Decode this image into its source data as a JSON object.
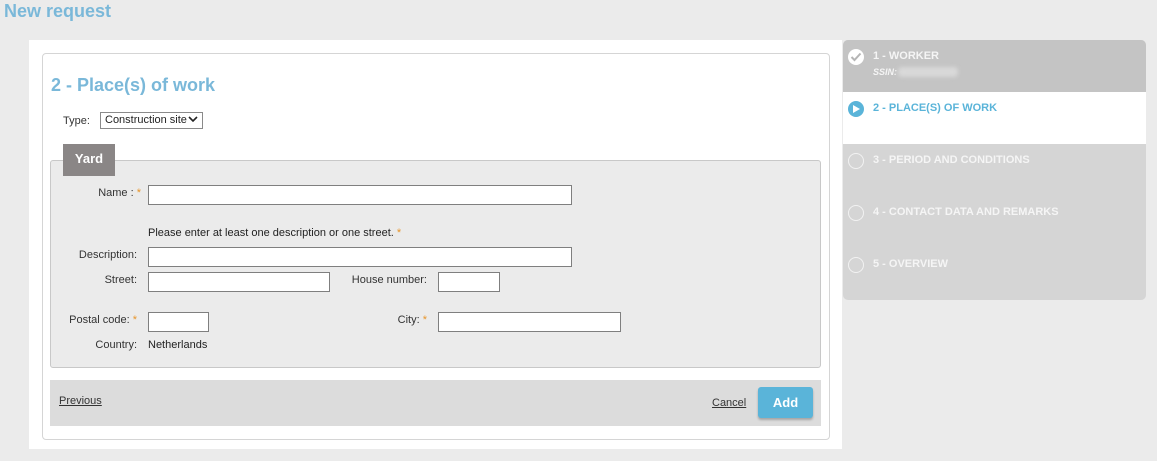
{
  "page": {
    "title": "New request"
  },
  "form": {
    "section_title": "2 - Place(s) of work",
    "type_label": "Type:",
    "type_value": "Construction site",
    "yard_tab": "Yard",
    "name_label": "Name :",
    "required_mark": "*",
    "hint": "Please enter at least one description or one street.",
    "description_label": "Description:",
    "street_label": "Street:",
    "house_number_label": "House number:",
    "postal_code_label": "Postal code:",
    "city_label": "City:",
    "country_label": "Country:",
    "country_value": "Netherlands",
    "name_value": "",
    "description_value": "",
    "street_value": "",
    "house_number_value": "",
    "postal_code_value": "",
    "city_value": ""
  },
  "footer": {
    "previous": "Previous",
    "cancel": "Cancel",
    "add": "Add"
  },
  "steps": [
    {
      "label": "1 - WORKER",
      "sub": "SSIN:",
      "state": "done"
    },
    {
      "label": "2 - PLACE(S) OF WORK",
      "state": "active"
    },
    {
      "label": "3 - PERIOD AND CONDITIONS",
      "state": "pending"
    },
    {
      "label": "4 - CONTACT DATA AND REMARKS",
      "state": "pending"
    },
    {
      "label": "5 - OVERVIEW",
      "state": "pending"
    }
  ],
  "colors": {
    "accent": "#5ab4d9",
    "title": "#7ab8d9",
    "required": "#e8952a",
    "tab": "#8a8686"
  },
  "icons": [
    "checkmark-icon",
    "play-icon",
    "chevron-down-icon"
  ]
}
